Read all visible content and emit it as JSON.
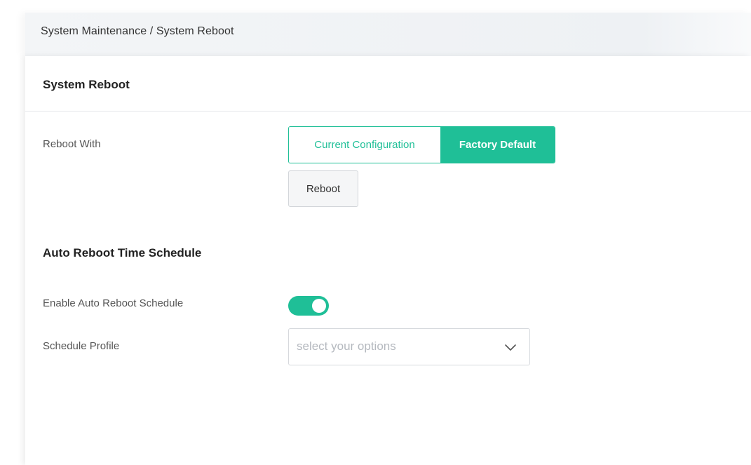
{
  "breadcrumb": "System Maintenance / System Reboot",
  "panel": {
    "title": "System Reboot"
  },
  "reboot_with": {
    "label": "Reboot With",
    "options": [
      {
        "label": "Current Configuration",
        "selected": false
      },
      {
        "label": "Factory Default",
        "selected": true
      }
    ],
    "reboot_button": "Reboot"
  },
  "auto_reboot": {
    "section_title": "Auto Reboot Time Schedule",
    "enable_label": "Enable Auto Reboot Schedule",
    "enabled": true,
    "profile_label": "Schedule Profile",
    "profile_placeholder": "select your options"
  },
  "icons": {
    "select_arrow": "chevron-down-icon"
  },
  "colors": {
    "accent": "#1fbf97",
    "header_bg": "#f3f5f7",
    "label_text": "#555555",
    "placeholder_text": "#b5b9bf"
  }
}
